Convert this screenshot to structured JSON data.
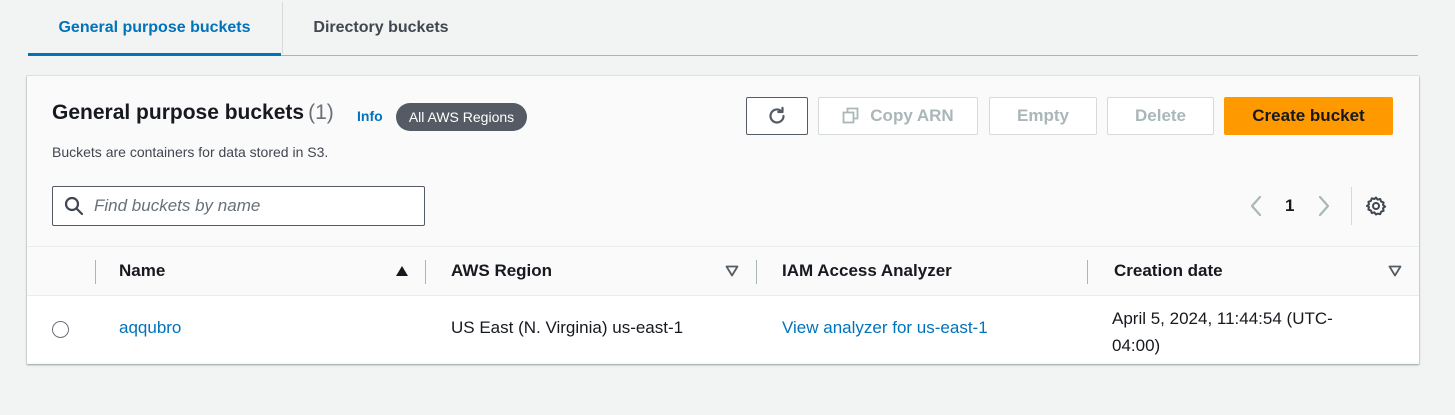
{
  "tabs": [
    {
      "label": "General purpose buckets",
      "active": true
    },
    {
      "label": "Directory buckets",
      "active": false
    }
  ],
  "header": {
    "title": "General purpose buckets",
    "count": "(1)",
    "info": "Info",
    "region_badge": "All AWS Regions",
    "description": "Buckets are containers for data stored in S3."
  },
  "actions": {
    "refresh_icon": "refresh-icon",
    "copy_arn": "Copy ARN",
    "empty": "Empty",
    "delete": "Delete",
    "create": "Create bucket"
  },
  "search": {
    "placeholder": "Find buckets by name",
    "value": ""
  },
  "pagination": {
    "current_page": "1"
  },
  "table": {
    "columns": [
      {
        "label": "Name",
        "sort": "ascending"
      },
      {
        "label": "AWS Region",
        "sort": "none"
      },
      {
        "label": "IAM Access Analyzer",
        "sort": ""
      },
      {
        "label": "Creation date",
        "sort": "none"
      }
    ],
    "rows": [
      {
        "name": "aqqubro",
        "region": "US East (N. Virginia) us-east-1",
        "iam": "View analyzer for us-east-1",
        "created": "April 5, 2024, 11:44:54 (UTC-04:00)"
      }
    ]
  },
  "colors": {
    "link": "#0073bb",
    "primary_button": "#ff9900",
    "badge": "#545b64",
    "background": "#f2f3f3"
  }
}
